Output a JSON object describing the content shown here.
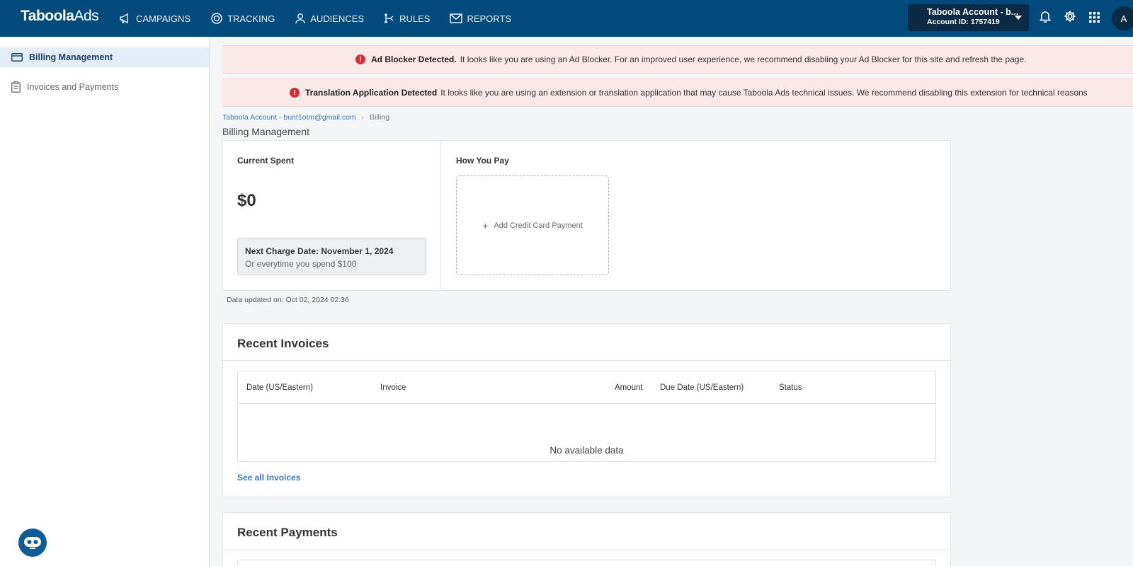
{
  "header": {
    "logo_bold": "Taboola",
    "logo_light": "Ads",
    "nav": [
      {
        "label": "CAMPAIGNS",
        "icon": "megaphone-icon"
      },
      {
        "label": "TRACKING",
        "icon": "tracking-icon"
      },
      {
        "label": "AUDIENCES",
        "icon": "user-icon"
      },
      {
        "label": "RULES",
        "icon": "rules-icon"
      },
      {
        "label": "REPORTS",
        "icon": "mail-icon"
      }
    ],
    "account_name": "Taboola Account - b...",
    "account_id": "Account ID: 1757419",
    "avatar_initial": "A"
  },
  "sidebar": {
    "items": [
      {
        "label": "Billing Management",
        "icon": "credit-card-icon",
        "active": true
      },
      {
        "label": "Invoices and Payments",
        "icon": "clipboard-icon",
        "active": false
      }
    ]
  },
  "banners": {
    "adblock_title": "Ad Blocker Detected.",
    "adblock_text": "It looks like you are using an Ad Blocker. For an improved user experience, we recommend disabling your Ad Blocker for this site and refresh the page.",
    "translation_title": "Translation Application Detected",
    "translation_text": "It looks like you are using an extension or translation application that may cause Taboola Ads technical issues. We recommend disabling this extension for technical reasons"
  },
  "breadcrumb": {
    "account": "Taboola Account - bunt1otm@gmail.com",
    "current": "Billing"
  },
  "page_title": "Billing Management",
  "billing": {
    "current_spent_label": "Current Spent",
    "current_spent_value": "$0",
    "next_charge": "Next Charge Date: November 1, 2024",
    "threshold": "Or everytime you spend $100",
    "how_you_pay_label": "How You Pay",
    "add_card_label": "Add Credit Card Payment",
    "updated": "Data updated on: Oct 02, 2024 02:36"
  },
  "invoices": {
    "title": "Recent Invoices",
    "columns": [
      "Date (US/Eastern)",
      "Invoice",
      "Amount",
      "Due Date (US/Eastern)",
      "Status"
    ],
    "empty": "No available data",
    "see_all": "See all Invoices"
  },
  "payments": {
    "title": "Recent Payments"
  },
  "colors": {
    "navbar": "#004b7c",
    "accent": "#3b78c4",
    "error": "#d32f3b",
    "banner_bg": "#fbe9e8"
  }
}
